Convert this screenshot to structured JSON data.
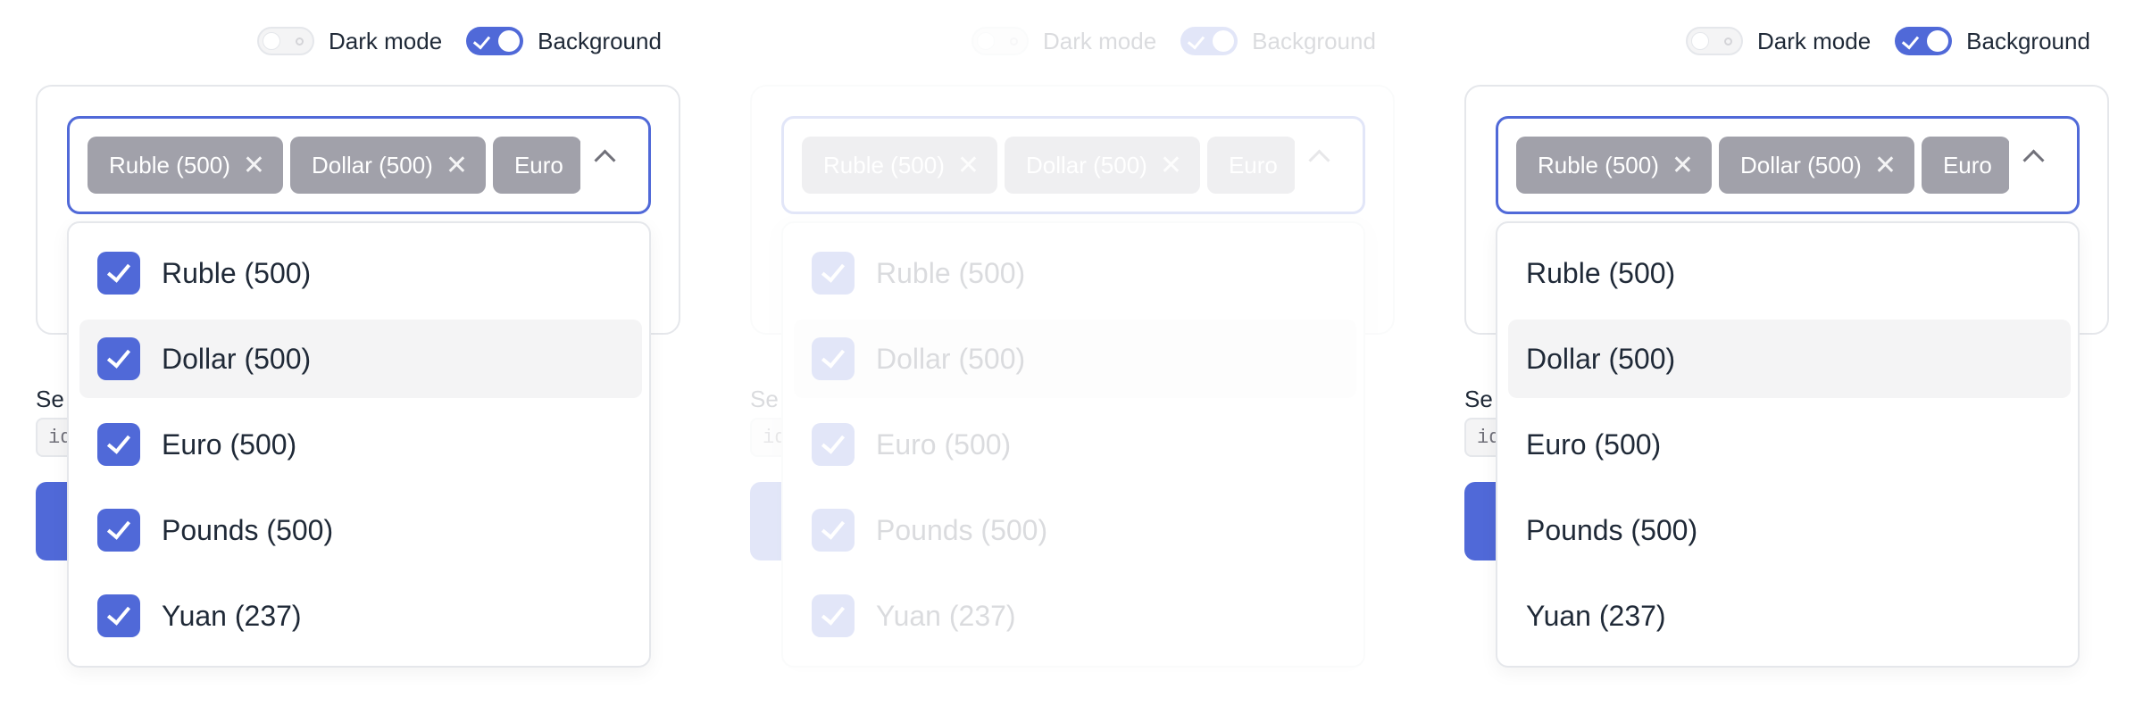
{
  "toggles": {
    "dark_mode_label": "Dark mode",
    "background_label": "Background",
    "dark_mode_on": false,
    "background_on": true
  },
  "select": {
    "chips": [
      {
        "label": "Ruble (500)"
      },
      {
        "label": "Dollar (500)"
      },
      {
        "label": "Euro"
      }
    ]
  },
  "helper": {
    "label": "Se",
    "code": "id"
  },
  "options": [
    {
      "label": "Ruble (500)",
      "checked": true
    },
    {
      "label": "Dollar (500)",
      "checked": true
    },
    {
      "label": "Euro (500)",
      "checked": true
    },
    {
      "label": "Pounds (500)",
      "checked": true
    },
    {
      "label": "Yuan (237)",
      "checked": true
    }
  ],
  "colors": {
    "accent": "#5069d8",
    "chip": "#a1a1aa",
    "hover": "#f4f4f5"
  }
}
